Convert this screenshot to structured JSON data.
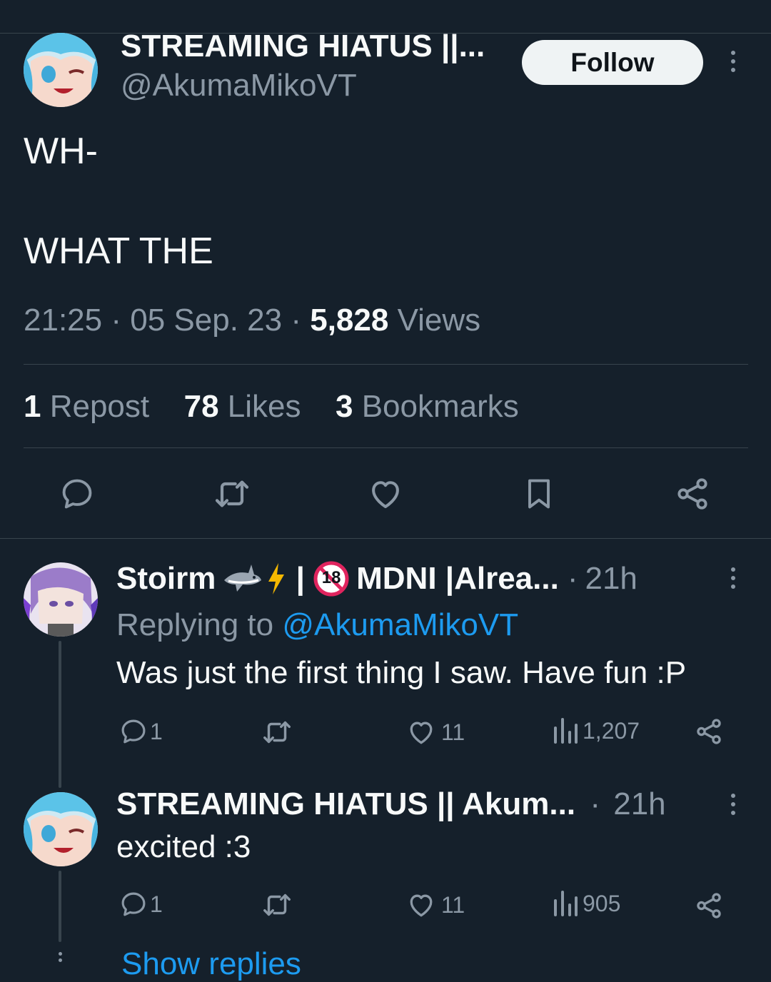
{
  "main_tweet": {
    "display_name": "STREAMING HIATUS ||...",
    "handle": "@AkumaMikoVT",
    "follow_label": "Follow",
    "text_line_1": "WH-",
    "text_line_2": "WHAT THE",
    "time": "21:25",
    "date": "05 Sep. 23",
    "separator": "·",
    "views_count": "5,828",
    "views_label": "Views",
    "reposts_count": "1",
    "reposts_label": "Repost",
    "likes_count": "78",
    "likes_label": "Likes",
    "bookmarks_count": "3",
    "bookmarks_label": "Bookmarks"
  },
  "replies": [
    {
      "display_name": "Stoirm",
      "display_name_rest": " | ",
      "display_name_tail": "MDNI |Alrea...",
      "badge_18": "18",
      "separator": "·",
      "age": "21h",
      "replying_prefix": "Replying to",
      "replying_handle": "@AkumaMikoVT",
      "text": "Was just the first thing I saw. Have fun :P",
      "reply_count": "1",
      "like_count": "11",
      "view_count": "1,207"
    },
    {
      "display_name": "STREAMING HIATUS || Akum...",
      "separator": "·",
      "age": "21h",
      "text": "excited :3",
      "reply_count": "1",
      "like_count": "11",
      "view_count": "905"
    }
  ],
  "show_replies_label": "Show replies",
  "colors": {
    "background": "#15202b",
    "divider": "#38444d",
    "secondary_text": "#8b98a5",
    "accent": "#1d9bf0"
  }
}
